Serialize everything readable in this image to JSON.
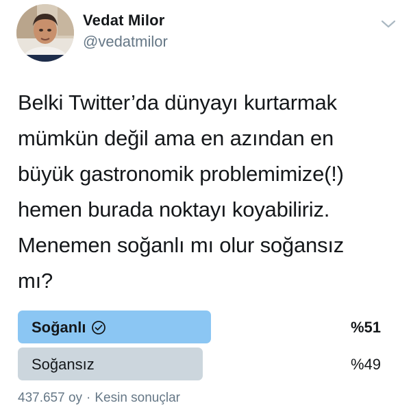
{
  "author": {
    "display_name": "Vedat Milor",
    "handle": "@vedatmilor"
  },
  "tweet": {
    "lines": [
      "Belki Twitter’da dünyayı kurtarmak",
      "mümkün değil ama en azından en",
      "büyük gastronomik problemimize(!)",
      "hemen burada noktayı koyabiliriz.",
      "Menemen soğanlı mı olur soğansız",
      "mı?"
    ]
  },
  "poll": {
    "options": [
      {
        "label": "Soğanlı",
        "percent_label": "%51",
        "percent": 51,
        "winner": true,
        "color": "#8bc6f3"
      },
      {
        "label": "Soğansız",
        "percent_label": "%49",
        "percent": 49,
        "winner": false,
        "color": "#ccd6dd"
      }
    ],
    "votes": "437.657 oy",
    "separator": "·",
    "status": "Kesin sonuçlar"
  },
  "icons": {
    "menu": "chevron-down-icon",
    "winner": "check-circle-icon"
  },
  "colors": {
    "text": "#14171a",
    "secondary": "#657786",
    "winner_bar": "#8bc6f3",
    "loser_bar": "#ccd6dd"
  }
}
